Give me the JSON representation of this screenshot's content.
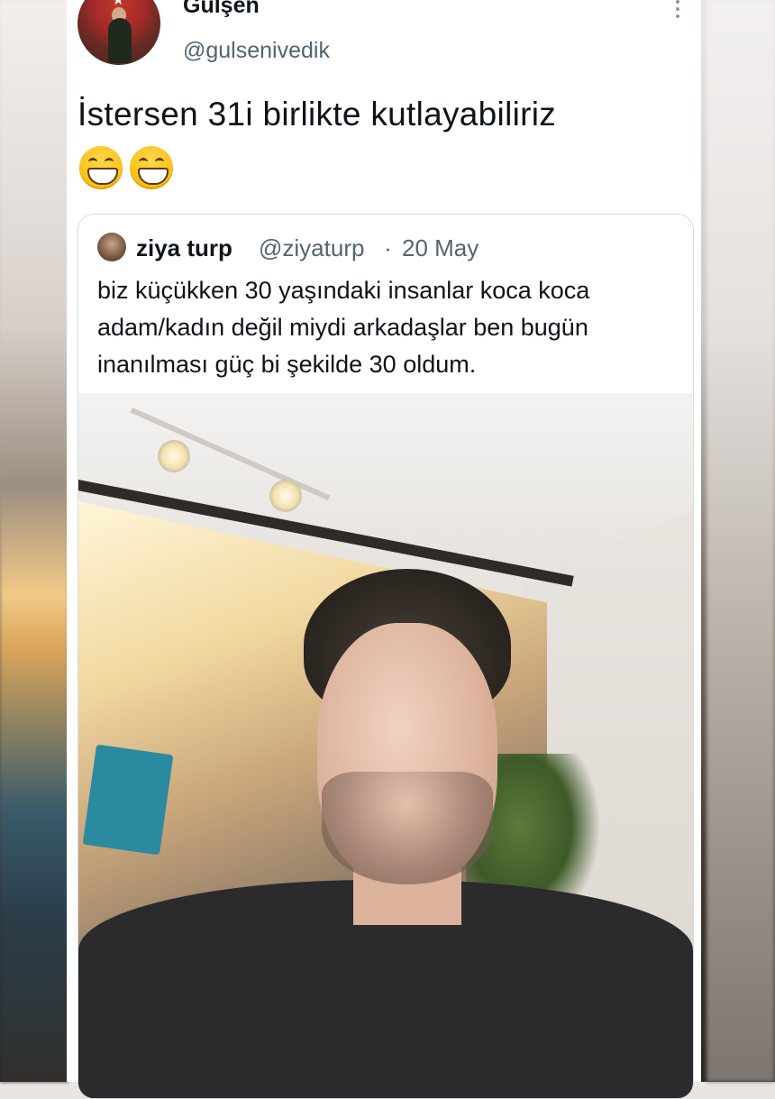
{
  "tweet": {
    "author_name": "Gülşen",
    "author_handle": "@gulsenivedik",
    "text": "İstersen 31i birlikte kutlayabiliriz",
    "emojis": [
      "grinning-face-with-smiling-eyes",
      "grinning-face-with-smiling-eyes"
    ]
  },
  "quoted_tweet": {
    "author_name": "ziya turp",
    "author_handle": "@ziyaturp",
    "separator": "·",
    "date": "20 May",
    "text_lines": [
      "biz küçükken 30 yaşındaki insanlar koca koca",
      "adam/kadın değil miydi arkadaşlar ben bugün",
      "inanılması güç bi şekilde 30 oldum."
    ],
    "photo_icon": "selfie-photo"
  },
  "colors": {
    "primary_text": "#0f1419",
    "secondary_text": "#536471",
    "border": "#d5dde2",
    "card_bg": "#ffffff"
  }
}
